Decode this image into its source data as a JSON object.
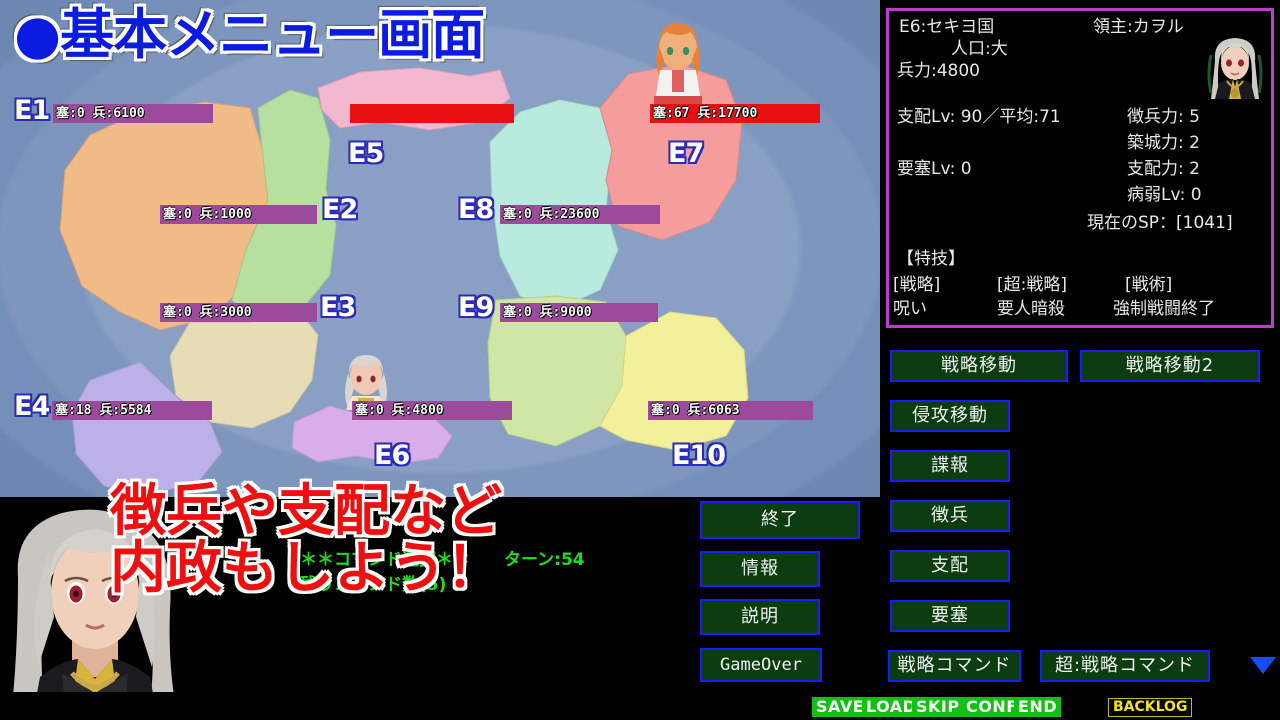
{
  "map": {
    "title": "●基本メニュー画面",
    "regions": [
      {
        "id": "E1",
        "label": "E1",
        "fort": "塞:0",
        "troops": "兵:6100",
        "bar_text": "塞:0  兵:6100",
        "owner": "player",
        "color": "#f0bb86"
      },
      {
        "id": "E2",
        "label": "E2",
        "fort": "塞:0",
        "troops": "兵:1000",
        "bar_text": "塞:0  兵:1000",
        "owner": "player",
        "color": "#b6dfa0"
      },
      {
        "id": "E3",
        "label": "E3",
        "fort": "塞:0",
        "troops": "兵:3000",
        "bar_text": "塞:0  兵:3000",
        "owner": "player",
        "color": "#e6dcb6"
      },
      {
        "id": "E4",
        "label": "E4",
        "fort": "塞:18",
        "troops": "兵:5584",
        "bar_text": "塞:18  兵:5584",
        "owner": "player",
        "color": "#bbb0e8"
      },
      {
        "id": "E5",
        "label": "E5",
        "fort": "",
        "troops": "",
        "bar_text": "",
        "owner": "enemy",
        "color": "#f3b7cf"
      },
      {
        "id": "E6",
        "label": "E6",
        "fort": "塞:0",
        "troops": "兵:4800",
        "bar_text": "塞:0  兵:4800",
        "owner": "player",
        "color": "#d9aee8"
      },
      {
        "id": "E7",
        "label": "E7",
        "fort": "塞:67",
        "troops": "兵:17700",
        "bar_text": "塞:67  兵:17700",
        "owner": "enemy",
        "color": "#f59c9c"
      },
      {
        "id": "E8",
        "label": "E8",
        "fort": "塞:0",
        "troops": "兵:23600",
        "bar_text": "塞:0  兵:23600",
        "owner": "player",
        "color": "#b8ebdd"
      },
      {
        "id": "E9",
        "label": "E9",
        "fort": "塞:0",
        "troops": "兵:9000",
        "bar_text": "塞:0  兵:9000",
        "owner": "player",
        "color": "#cfe6a4"
      },
      {
        "id": "E10",
        "label": "E10",
        "fort": "塞:0",
        "troops": "兵:6063",
        "bar_text": "塞:0  兵:6063",
        "owner": "player",
        "color": "#f2f09a"
      }
    ]
  },
  "caption": {
    "line1": "徴兵や支配など",
    "line2": "内政もしよう！"
  },
  "status": {
    "line1": "＊＊コマンド選択＊＊　　ターン:54",
    "line2": "残りコマンド数(5)"
  },
  "info": {
    "region": "E6:セキヨ国",
    "lord": "領主:カヲル",
    "population": "人口:大",
    "troops": "兵力:4800",
    "rule_level": "支配Lv: 90／平均:71",
    "fort_level": "要塞Lv: 0",
    "conscription_power": "徴兵力: 5",
    "construction_power": "築城力: 2",
    "rule_power": "支配力: 2",
    "sickness_level": "病弱Lv: 0",
    "current_sp": "現在のSP：[1041]",
    "skills_header": "【特技】",
    "skill_cat_1": "[戦略]",
    "skill_cat_2": "[超:戦略]",
    "skill_cat_3": "[戦術]",
    "skill_1": "呪い",
    "skill_2": "要人暗殺",
    "skill_3": "強制戦闘終了"
  },
  "commands": {
    "left": [
      {
        "label": "終了"
      },
      {
        "label": "情報"
      },
      {
        "label": "説明"
      },
      {
        "label": "GameOver"
      }
    ],
    "right": [
      {
        "label": "戦略移動"
      },
      {
        "label": "戦略移動2"
      },
      {
        "label": "侵攻移動"
      },
      {
        "label": "諜報"
      },
      {
        "label": "徴兵"
      },
      {
        "label": "支配"
      },
      {
        "label": "要塞"
      },
      {
        "label": "戦略コマンド"
      },
      {
        "label": "超:戦略コマンド"
      }
    ]
  },
  "system_bar": {
    "save": "SAVE",
    "load": "LOAD",
    "skip": "SKIP",
    "conf": "CONF",
    "end": "END",
    "backlog": "BACKLOG"
  },
  "colors": {
    "panel_border": "#c03cd0",
    "button_border": "#1b1bff",
    "button_fill": "#0b3d10",
    "status_green": "#19e019",
    "caption_red": "#ee1010",
    "title_blue": "#0b1ce0",
    "bar_player": "#9c4b9c",
    "bar_enemy": "#e81010"
  }
}
